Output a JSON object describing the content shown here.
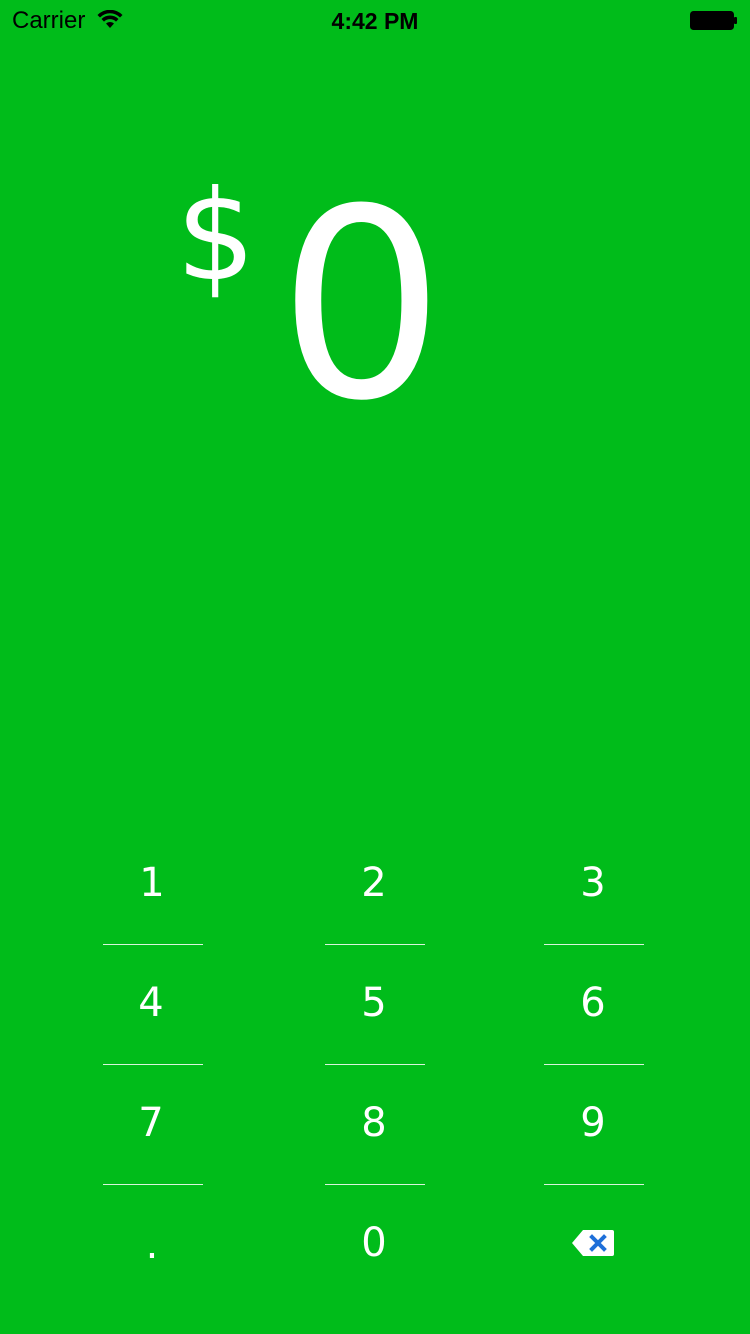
{
  "status_bar": {
    "carrier": "Carrier",
    "time": "4:42 PM"
  },
  "amount": {
    "currency_symbol": "$",
    "value": "0"
  },
  "keypad": {
    "keys": [
      "1",
      "2",
      "3",
      "4",
      "5",
      "6",
      "7",
      "8",
      "9",
      ".",
      "0"
    ],
    "backspace_icon": "backspace-icon"
  },
  "colors": {
    "background": "#00BC1A",
    "text": "#FFFFFF",
    "backspace_x": "#1E6FD9"
  }
}
